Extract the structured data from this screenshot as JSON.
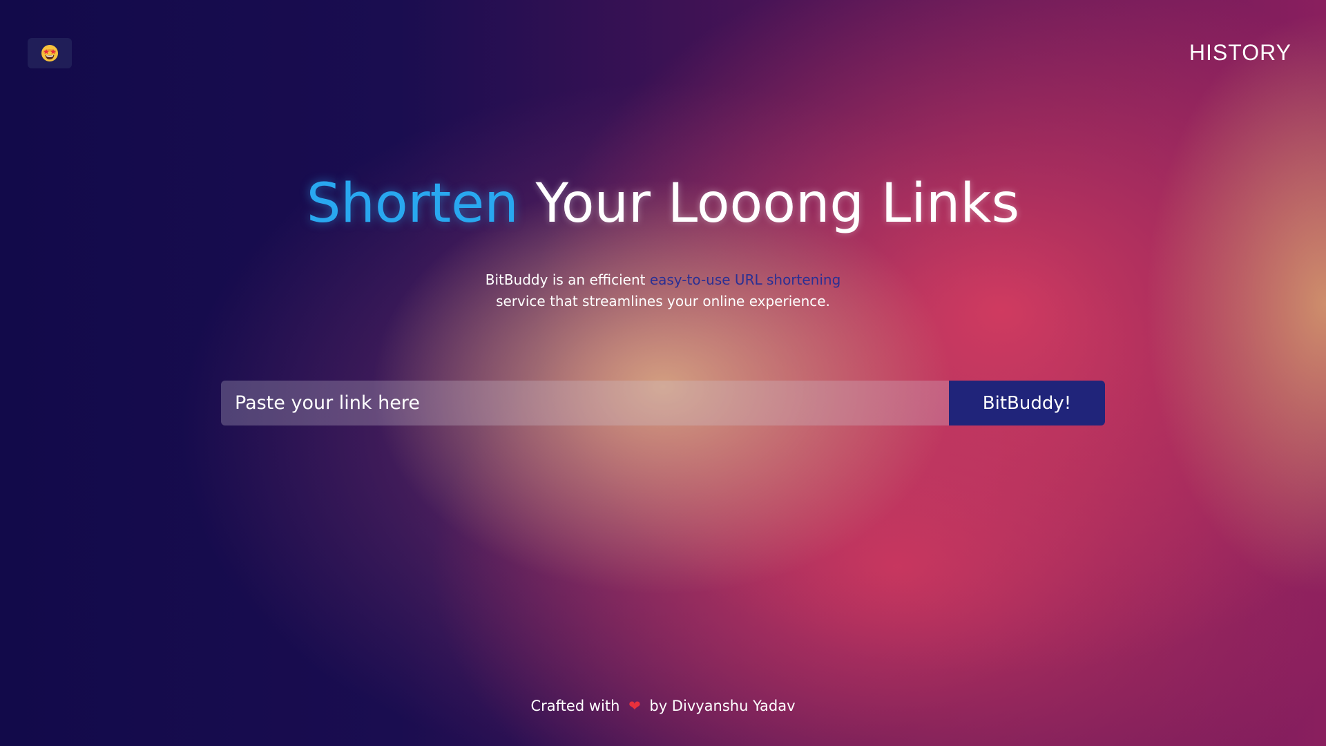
{
  "header": {
    "logo_icon": "star-struck-emoji-icon",
    "history_label": "HISTORY"
  },
  "hero": {
    "title_accent": "Shorten",
    "title_rest": "Your Looong Links",
    "subtitle_part1": "BitBuddy is an efficient ",
    "subtitle_highlight": "easy-to-use URL shortening",
    "subtitle_part2": "service that streamlines your online experience."
  },
  "form": {
    "input_placeholder": "Paste your link here",
    "input_value": "",
    "submit_label": "BitBuddy!"
  },
  "footer": {
    "prefix": "Crafted with",
    "icon": "heart-icon",
    "suffix": "by Divyanshu Yadav"
  },
  "colors": {
    "accent": "#29a8f0",
    "button": "#20247a",
    "highlight": "#2a2f94",
    "heart": "#e8303c"
  }
}
